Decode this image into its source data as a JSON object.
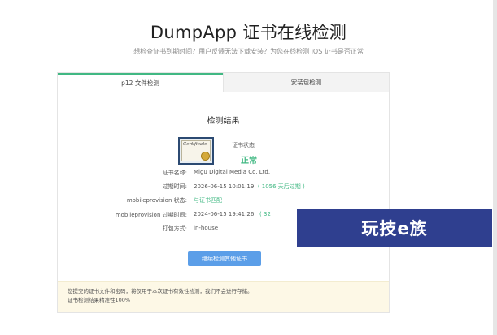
{
  "header": {
    "title": "DumpApp 证书在线检测",
    "subtitle": "想检查证书到期时间？用户反馈无法下载安装？为您在线检测 iOS 证书是否正常"
  },
  "tabs": [
    {
      "label": "p12 文件检测",
      "active": true
    },
    {
      "label": "安装包检测",
      "active": false
    }
  ],
  "result": {
    "title": "检测结果",
    "status_label": "证书状态",
    "status_value": "正常",
    "status_color": "#41b883",
    "rows": [
      {
        "label": "证书名称:",
        "value": "Migu Digital Media Co. Ltd.",
        "extra": ""
      },
      {
        "label": "过期时间:",
        "value": "2026-06-15 10:01:19",
        "extra": "( 1056 天后过期 )"
      },
      {
        "label": "mobileprovision 状态:",
        "value": "",
        "extra": "与证书匹配"
      },
      {
        "label": "mobileprovision 过期时间:",
        "value": "2024-06-15 19:41:26",
        "extra": "( 32"
      },
      {
        "label": "打包方式:",
        "value": "in-house",
        "extra": ""
      }
    ],
    "button_label": "继续检测其他证书",
    "certificate_text": "Certificate"
  },
  "notice": {
    "line1": "您提交的证书文件和密码，将仅用于本次证书有效性检测，我们不会进行存储。",
    "line2": "证书检测结果精准性100%"
  },
  "watermark": {
    "text": "玩技e族"
  }
}
